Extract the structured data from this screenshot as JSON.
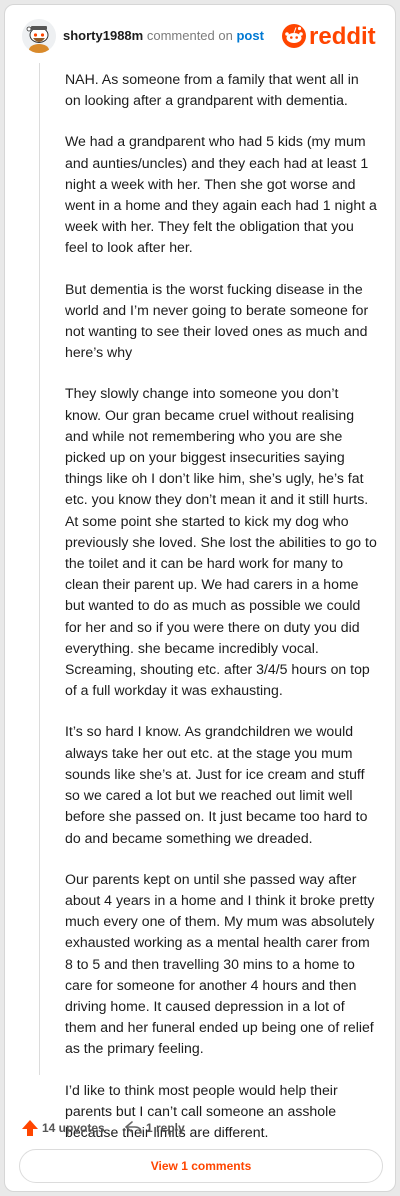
{
  "header": {
    "username": "shorty1988m",
    "action": "commented on",
    "post_link": "post",
    "logo_text": "reddit"
  },
  "comment": {
    "paragraphs": [
      "NAH. As someone from a family that went all in on looking after a grandparent with dementia.",
      "We had a grandparent who had 5 kids (my mum and aunties/uncles) and they each had at least 1 night a week with her. Then she got worse and went in a home and they again each had 1 night a week with her. They felt the obligation that you feel to look after her.",
      "But dementia is the worst fucking disease in the world and I’m never going to berate someone for not wanting to see their loved ones as much and here’s why",
      "They slowly change into someone you don’t know. Our gran became cruel without realising and while not remembering who you are she picked up on your biggest insecurities saying things like oh I don’t like him, she’s ugly, he’s fat etc. you know they don’t mean it and it still hurts. At some point she started to kick my dog who previously she loved. She lost the abilities to go to the toilet and it can be hard work for many to clean their parent up. We had carers in a home but wanted to do as much as possible we could for her and so if you were there on duty you did everything. she became incredibly vocal. Screaming, shouting etc. after 3/4/5 hours on top of a full workday it was exhausting.",
      "It’s so hard I know. As grandchildren we would always take her out etc. at the stage you mum sounds like she’s at. Just for ice cream and stuff so we cared a lot but we reached out limit well before she passed on. It just became too hard to do and became something we dreaded.",
      "Our parents kept on until she passed way after about 4 years in a home and I think it broke pretty much every one of them. My mum was absolutely exhausted working as a mental health carer from 8 to 5 and then travelling 30 mins to a home to care for someone for another 4 hours and then driving home. It caused depression in a lot of them and her funeral ended up being one of relief as the primary feeling.",
      "I’d like to think most people would help their parents but I can’t call someone an asshole because their limits are different."
    ]
  },
  "footer": {
    "upvotes": "14 upvotes",
    "replies": "1 reply",
    "view_comments": "View 1 comments"
  },
  "colors": {
    "brand": "#ff4500",
    "link": "#0079d3",
    "muted": "#7c7c7c"
  },
  "icons": {
    "avatar": "snoo-avatar-icon",
    "logo": "reddit-logo-icon",
    "upvote": "upvote-arrow-icon",
    "reply": "reply-arrow-icon"
  }
}
